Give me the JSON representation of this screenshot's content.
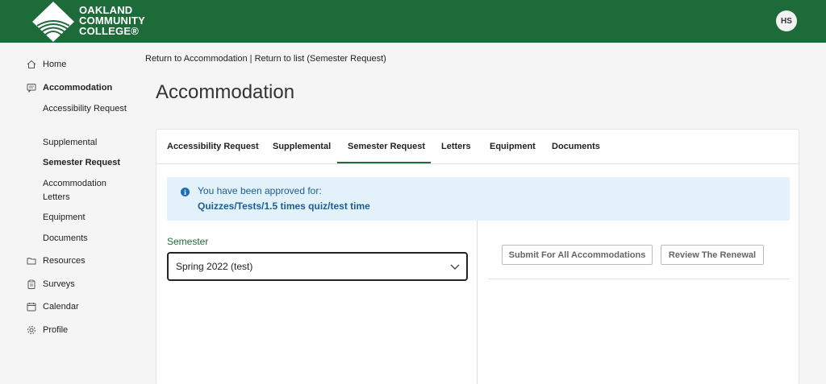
{
  "header": {
    "logo_lines": [
      "OAKLAND",
      "COMMUNITY",
      "COLLEGE®"
    ],
    "avatar_initials": "HS",
    "brand_color": "#1e6b3a"
  },
  "sidebar": {
    "items": [
      {
        "label": "Home",
        "icon": "home-icon"
      },
      {
        "label": "Accommodation",
        "icon": "chat-icon",
        "active": true
      },
      {
        "label": "Resources",
        "icon": "folder-icon"
      },
      {
        "label": "Surveys",
        "icon": "clipboard-icon"
      },
      {
        "label": "Calendar",
        "icon": "calendar-icon"
      },
      {
        "label": "Profile",
        "icon": "gear-icon"
      }
    ],
    "sub_items": [
      {
        "label": "Accessibility Request"
      },
      {
        "label": "Supplemental"
      },
      {
        "label": "Semester Request",
        "active": true
      },
      {
        "label": "Accommodation Letters"
      },
      {
        "label": "Equipment"
      },
      {
        "label": "Documents"
      }
    ]
  },
  "breadcrumb": {
    "link1": "Return to Accommodation",
    "separator": " | ",
    "link2": "Return to list (Semester Request)"
  },
  "page": {
    "title": "Accommodation"
  },
  "tabs": [
    {
      "label": "Accessibility Request"
    },
    {
      "label": "Supplemental"
    },
    {
      "label": "Semester Request",
      "active": true
    },
    {
      "label": "Letters"
    },
    {
      "label": "Equipment"
    },
    {
      "label": "Documents"
    }
  ],
  "alert": {
    "line1": "You have been approved for:",
    "line2": "Quizzes/Tests/1.5 times quiz/test time",
    "icon": "info-icon"
  },
  "semester": {
    "label": "Semester",
    "selected": "Spring 2022 (test)"
  },
  "actions": {
    "submit_label": "Submit For All Accommodations",
    "review_label": "Review The Renewal"
  }
}
